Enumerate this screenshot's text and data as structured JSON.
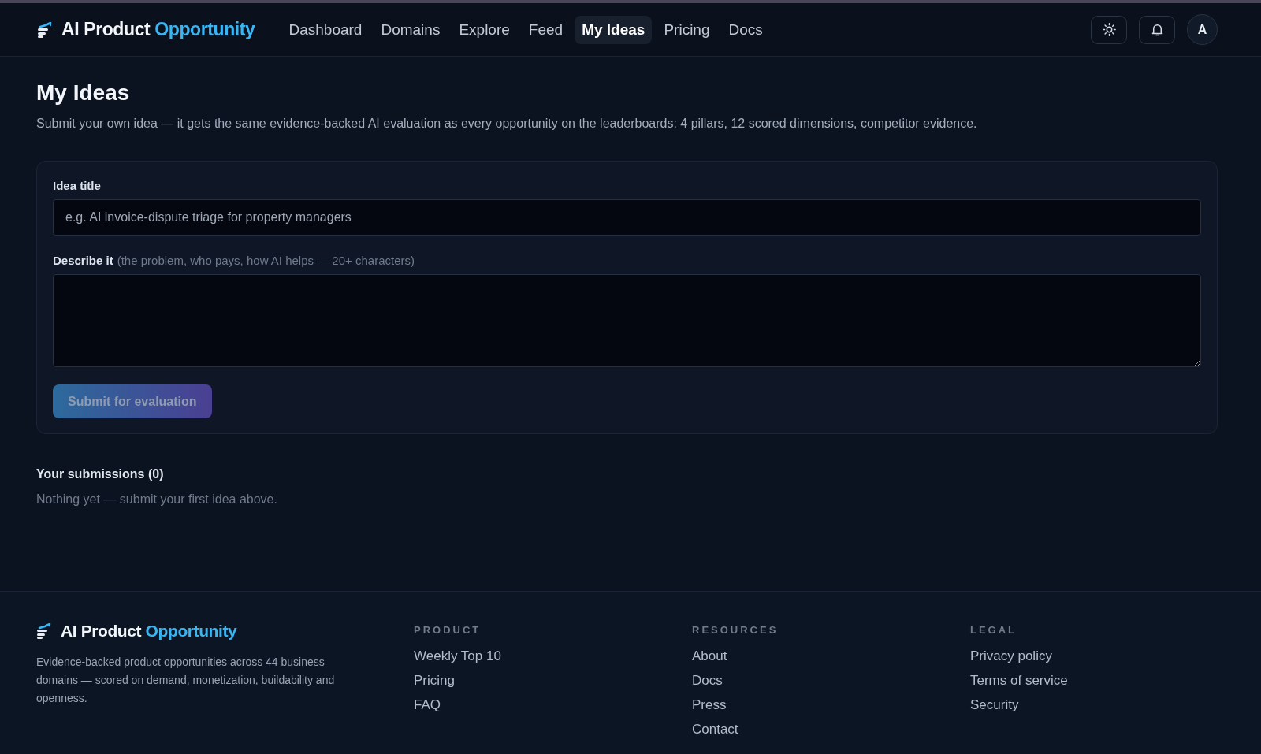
{
  "header": {
    "logo": {
      "text": "AI Product",
      "accent": "Opportunity"
    },
    "nav": [
      {
        "label": "Dashboard",
        "selected": false
      },
      {
        "label": "Domains",
        "selected": false
      },
      {
        "label": "Explore",
        "selected": false
      },
      {
        "label": "Feed",
        "selected": false
      },
      {
        "label": "My Ideas",
        "selected": true
      },
      {
        "label": "Pricing",
        "selected": false
      },
      {
        "label": "Docs",
        "selected": false
      }
    ],
    "avatar": "A"
  },
  "page": {
    "title": "My Ideas",
    "subtitle": "Submit your own idea — it gets the same evidence-backed AI evaluation as every opportunity on the leaderboards: 4 pillars, 12 scored dimensions, competitor evidence."
  },
  "form": {
    "fields": [
      {
        "kind": "input",
        "label": "Idea title",
        "placeholder": "e.g. AI invoice-dispute triage for property managers"
      },
      {
        "kind": "textarea",
        "label": "Describe it",
        "hint": "(the problem, who pays, how AI helps — 20+ characters)"
      }
    ],
    "submit": {
      "label": "Submit for evaluation",
      "disabled": true
    }
  },
  "submissions": {
    "heading": "Your submissions (0)",
    "empty": "Nothing yet — submit your first idea above."
  },
  "footer": {
    "logo": {
      "text": "AI Product",
      "accent": "Opportunity"
    },
    "description": "Evidence-backed product opportunities across 44 business domains — scored on demand, monetization, buildability and openness.",
    "columns": [
      {
        "heading": "PRODUCT",
        "links": [
          "Weekly Top 10",
          "Pricing",
          "FAQ"
        ]
      },
      {
        "heading": "RESOURCES",
        "links": [
          "About",
          "Docs",
          "Press",
          "Contact"
        ]
      },
      {
        "heading": "LEGAL",
        "links": [
          "Privacy policy",
          "Terms of service",
          "Security"
        ]
      }
    ]
  }
}
